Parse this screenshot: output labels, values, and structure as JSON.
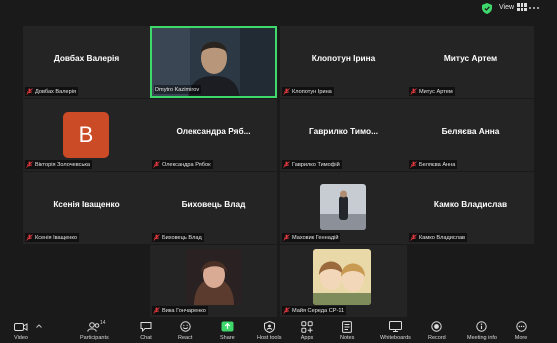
{
  "topbar": {
    "view_label": "View"
  },
  "self_view": {
    "name": "Dmytro Kazimirov"
  },
  "tiles": [
    {
      "display": "Довбах Валерія",
      "label": "Довбах Валерія"
    },
    {
      "display": "Клопотун Ірина",
      "label": "Клопотун Ірина"
    },
    {
      "display": "Митус Артем",
      "label": "Митус Артем"
    },
    {
      "avatar_letter": "B",
      "label": "Вікторія Золочевська"
    },
    {
      "display": "Олександра  Ряб...",
      "label": "Олександра Рябок"
    },
    {
      "display": "Гаврилко  Тимо...",
      "label": "Гаврилко Тимофій"
    },
    {
      "display": "Беляєва Анна",
      "label": "Беляєва Анна"
    },
    {
      "display": "Ксенія Іващенко",
      "label": "Ксенія Іващенко"
    },
    {
      "display": "Биховець Влад",
      "label": "Биховець Влад"
    },
    {
      "label": "Маховик Геннадій"
    },
    {
      "display": "Камко Владислав",
      "label": "Камко Владислав"
    },
    {
      "label": "Вика Гончаренко"
    },
    {
      "label": "Майя Середа СР-11"
    }
  ],
  "toolbar": {
    "video": "Video",
    "participants": "Participants",
    "participants_count": "14",
    "chat": "Chat",
    "react": "React",
    "share": "Share",
    "host_tools": "Host tools",
    "apps": "Apps",
    "notes": "Notes",
    "whiteboards": "Whiteboards",
    "record": "Record",
    "meeting_info": "Meeting info",
    "more": "More"
  },
  "colors": {
    "active_speaker_border": "#3fd96b",
    "avatar_bg": "#cc4b27",
    "share_icon": "#3fd96b",
    "muted_mic": "#e0383e",
    "shield": "#3fd96b"
  }
}
